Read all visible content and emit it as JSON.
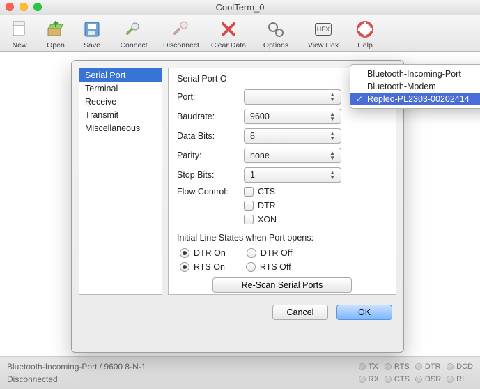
{
  "window": {
    "title": "CoolTerm_0"
  },
  "toolbar": {
    "new": "New",
    "open": "Open",
    "save": "Save",
    "connect": "Connect",
    "disconnect": "Disconnect",
    "clear": "Clear Data",
    "options": "Options",
    "viewhex": "View Hex",
    "hexglyph": "HEX",
    "help": "Help"
  },
  "options": {
    "categories": [
      "Serial Port",
      "Terminal",
      "Receive",
      "Transmit",
      "Miscellaneous"
    ],
    "selected_category": "Serial Port",
    "panel_title": "Serial Port O",
    "labels": {
      "port": "Port:",
      "baudrate": "Baudrate:",
      "databits": "Data Bits:",
      "parity": "Parity:",
      "stopbits": "Stop Bits:",
      "flowcontrol": "Flow Control:"
    },
    "values": {
      "baudrate": "9600",
      "databits": "8",
      "parity": "none",
      "stopbits": "1"
    },
    "flow": {
      "cts": "CTS",
      "dtr": "DTR",
      "xon": "XON"
    },
    "initial_title": "Initial Line States when Port opens:",
    "radios": {
      "dtr_on": "DTR On",
      "dtr_off": "DTR Off",
      "rts_on": "RTS On",
      "rts_off": "RTS Off"
    },
    "rescan": "Re-Scan Serial Ports",
    "cancel": "Cancel",
    "ok": "OK",
    "port_menu": {
      "items": [
        "Bluetooth-Incoming-Port",
        "Bluetooth-Modem",
        "Repleo-PL2303-00202414"
      ],
      "selected": "Repleo-PL2303-00202414"
    }
  },
  "status": {
    "line1": "Bluetooth-Incoming-Port / 9600 8-N-1",
    "line2": "Disconnected",
    "leds": {
      "tx": "TX",
      "rx": "RX",
      "rts": "RTS",
      "cts": "CTS",
      "dtr": "DTR",
      "dsr": "DSR",
      "dcd": "DCD",
      "ri": "RI"
    }
  }
}
